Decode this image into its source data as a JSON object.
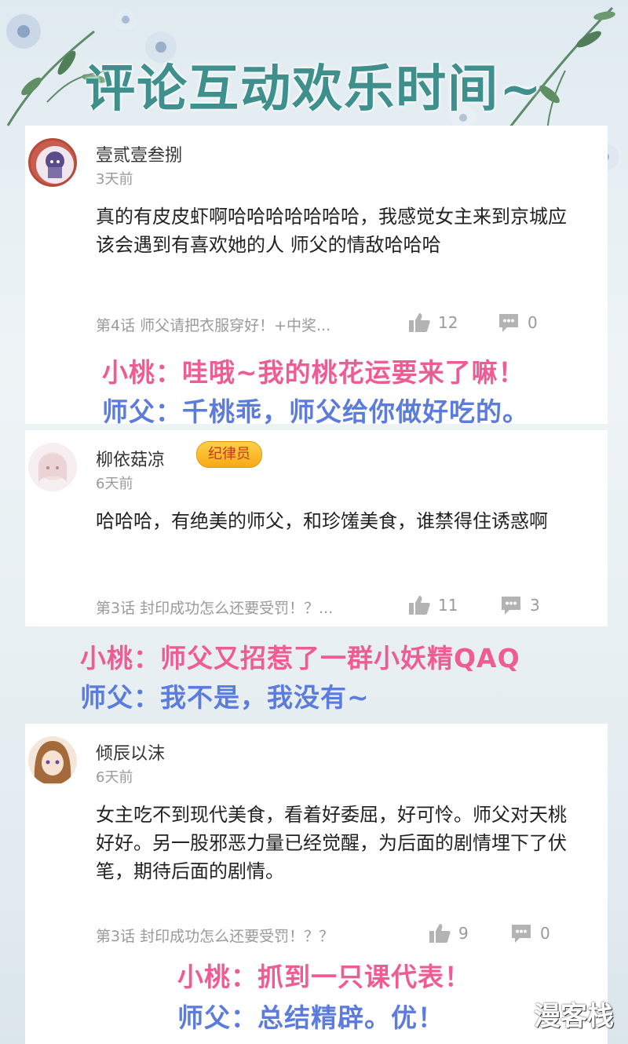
{
  "title": "评论互动欢乐时间~",
  "comments": [
    {
      "username": "壹贰壹叁捌",
      "time": "3天前",
      "text": "真的有皮皮虾啊哈哈哈哈哈哈哈，我感觉女主来到京城应该会遇到有喜欢她的人 师父的情敌哈哈哈",
      "chapter": "第4话 师父请把衣服穿好！+中奖...",
      "likes": "12",
      "replies": "0",
      "badge": ""
    },
    {
      "username": "柳依菇凉",
      "time": "6天前",
      "text": "哈哈哈，有绝美的师父，和珍馐美食，谁禁得住诱惑啊",
      "chapter": "第3话 封印成功怎么还要受罚！？...",
      "likes": "11",
      "replies": "3",
      "badge": "纪律员"
    },
    {
      "username": "倾辰以沫",
      "time": "6天前",
      "text": "女主吃不到现代美食，看着好委屈，好可怜。师父对天桃好好。另一股邪恶力量已经觉醒，为后面的剧情埋下了伏笔，期待后面的剧情。",
      "chapter": "第3话 封印成功怎么还要受罚！？？",
      "likes": "9",
      "replies": "0",
      "badge": ""
    }
  ],
  "dialogs": [
    {
      "line1": "小桃：哇哦~我的桃花运要来了嘛！",
      "line2": "师父：千桃乖，师父给你做好吃的。"
    },
    {
      "line1": "小桃：师父又招惹了一群小妖精QAQ",
      "line2": "师父：我不是，我没有~"
    },
    {
      "line1": "小桃：抓到一只课代表！",
      "line2": "师父：总结精辟。优！"
    }
  ],
  "watermark": "漫客栈",
  "icons": [
    "thumbs-up-icon",
    "comment-bubble-icon"
  ],
  "colors": {
    "title": "#3f8f8c",
    "pink": "#ef5b93",
    "blue": "#5b7cdc",
    "badge": "#f6a916"
  }
}
